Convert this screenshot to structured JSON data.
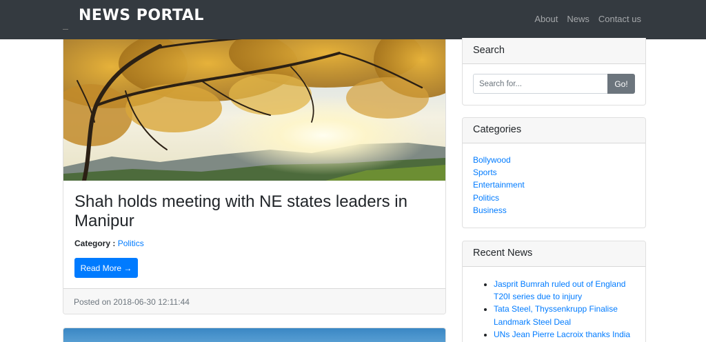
{
  "navbar": {
    "brand": "NEWS PORTAL",
    "links": [
      "About",
      "News",
      "Contact us"
    ]
  },
  "post": {
    "title": "Shah holds meeting with NE states leaders in Manipur",
    "category_label": "Category :",
    "category_value": "Politics",
    "read_more": "Read More →",
    "posted": "Posted on 2018-06-30 12:11:44"
  },
  "search": {
    "title": "Search",
    "placeholder": "Search for...",
    "button": "Go!"
  },
  "categories": {
    "title": "Categories",
    "items": [
      "Bollywood",
      "Sports",
      "Entertainment",
      "Politics",
      "Business"
    ]
  },
  "recent": {
    "title": "Recent News",
    "items": [
      "Jasprit Bumrah ruled out of England T20I series due to injury",
      "Tata Steel, Thyssenkrupp Finalise Landmark Steel Deal",
      "UNs Jean Pierre Lacroix thanks India"
    ]
  },
  "colors": {
    "navbar_bg": "#343a40",
    "link": "#007bff",
    "button_primary": "#007bff",
    "button_secondary": "#6c757d"
  }
}
